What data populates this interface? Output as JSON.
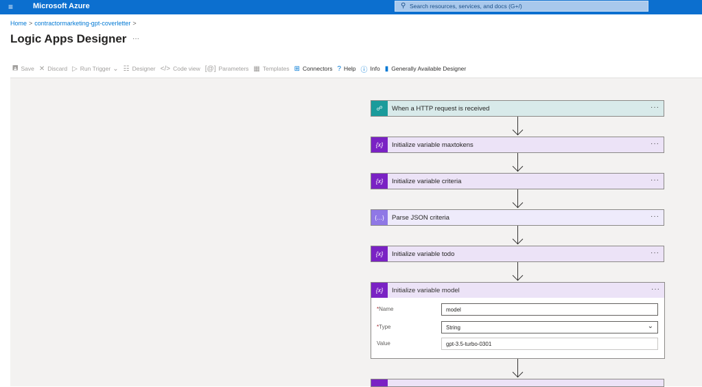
{
  "topbar": {
    "brand": "Microsoft Azure",
    "search_placeholder": "Search resources, services, and docs (G+/)"
  },
  "breadcrumb": {
    "home": "Home",
    "resource": "contractormarketing-gpt-coverletter"
  },
  "page": {
    "title": "Logic Apps Designer",
    "more": "···"
  },
  "toolbar": {
    "save": "Save",
    "discard": "Discard",
    "run_trigger": "Run Trigger",
    "designer": "Designer",
    "code_view": "Code view",
    "parameters": "Parameters",
    "templates": "Templates",
    "connectors": "Connectors",
    "help": "Help",
    "info": "Info",
    "ga_designer": "Generally Available Designer"
  },
  "steps": [
    {
      "label": "When a HTTP request is received",
      "icon": "http-trigger-icon"
    },
    {
      "label": "Initialize variable maxtokens",
      "icon": "variable-icon"
    },
    {
      "label": "Initialize variable criteria",
      "icon": "variable-icon"
    },
    {
      "label": "Parse JSON criteria",
      "icon": "parse-json-icon"
    },
    {
      "label": "Initialize variable todo",
      "icon": "variable-icon"
    }
  ],
  "expanded_step": {
    "label": "Initialize variable model",
    "fields": {
      "name_label": "Name",
      "name_value": "model",
      "type_label": "Type",
      "type_value": "String",
      "value_label": "Value",
      "value_value": "gpt-3.5-turbo-0301"
    }
  },
  "card_more": "···",
  "colors": {
    "azure_blue": "#0c6fcf",
    "variable_purple": "#7a22c4",
    "http_teal": "#1a9b9b",
    "parse_lavender": "#8f78e6"
  }
}
